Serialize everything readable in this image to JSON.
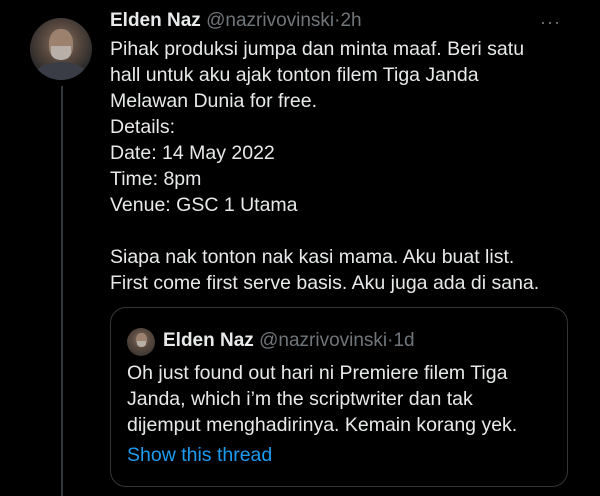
{
  "tweet": {
    "display_name": "Elden Naz",
    "handle": "@nazrivovinski",
    "separator": "·",
    "time": "2h",
    "more_icon": "···",
    "lines": [
      "Pihak produksi jumpa dan minta maaf. Beri satu",
      "hall untuk aku ajak tonton filem Tiga Janda",
      "Melawan Dunia for free.",
      "Details:",
      "Date: 14 May 2022",
      "Time: 8pm",
      "Venue: GSC 1 Utama",
      "",
      "Siapa nak tonton nak kasi mama. Aku buat list.",
      "First come first serve basis. Aku juga ada di sana."
    ]
  },
  "quoted_tweet": {
    "display_name": "Elden Naz",
    "handle": "@nazrivovinski",
    "separator": "·",
    "time": "1d",
    "lines": [
      "Oh just found out hari ni Premiere filem Tiga",
      "Janda, which i’m the scriptwriter dan tak",
      "dijemput menghadirinya. Kemain korang yek."
    ],
    "show_thread": "Show this thread"
  },
  "colors": {
    "background": "#000000",
    "text": "#e7e9ea",
    "muted": "#71767b",
    "link": "#1d9bf0",
    "border": "#333639"
  }
}
